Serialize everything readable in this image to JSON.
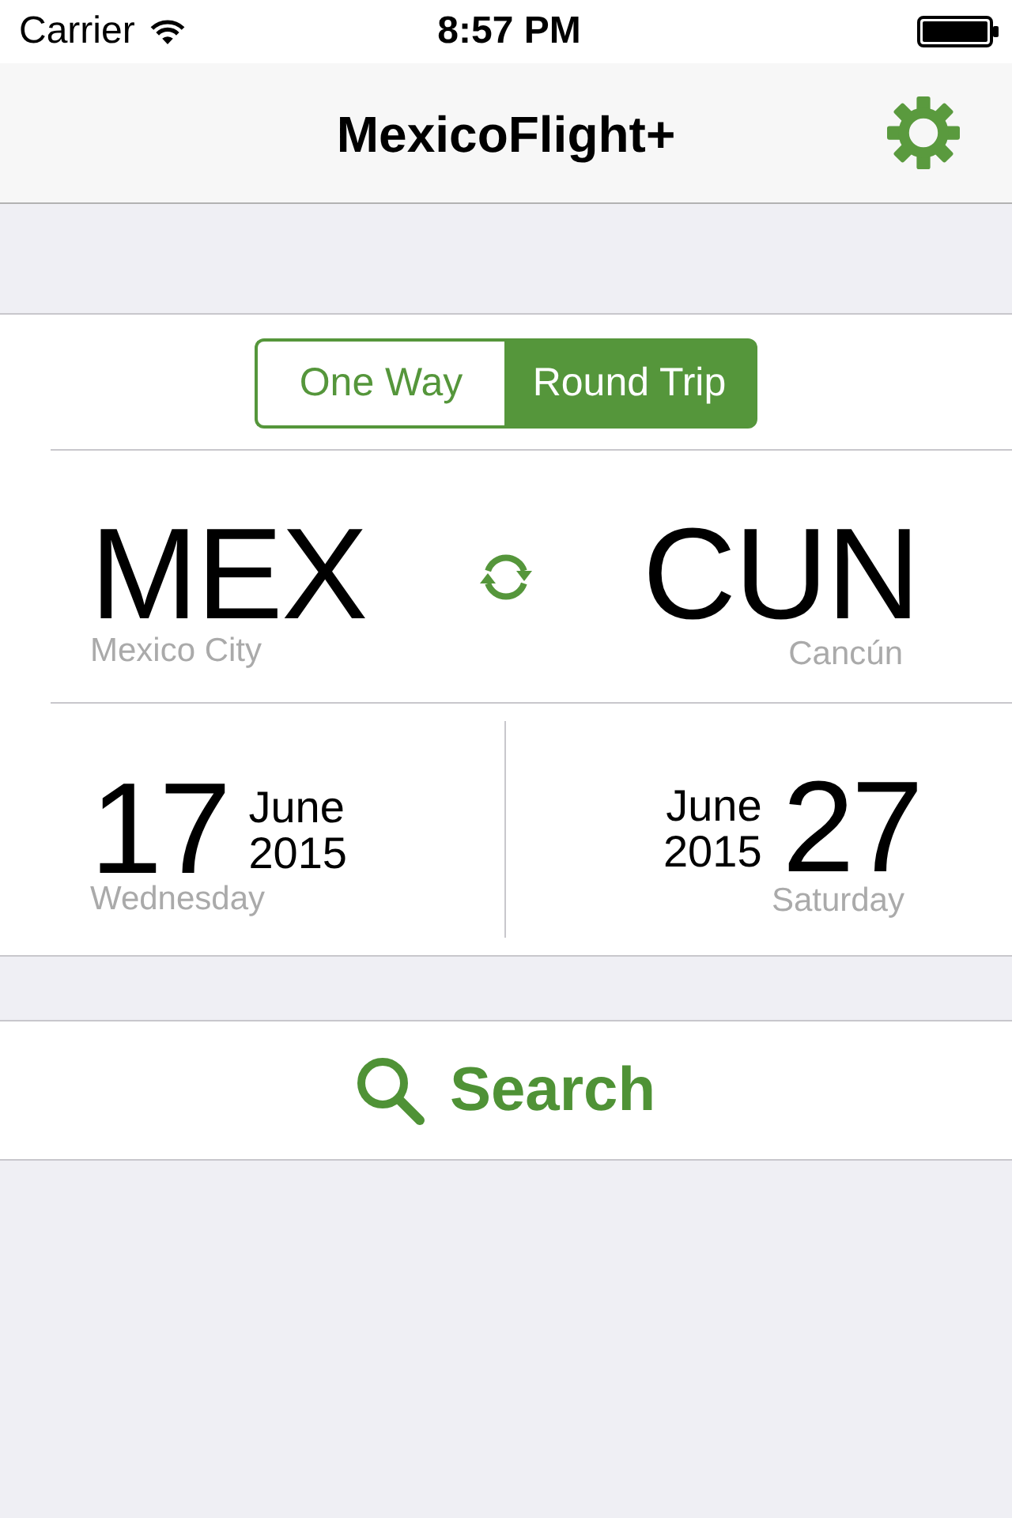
{
  "status_bar": {
    "carrier": "Carrier",
    "time": "8:57 PM"
  },
  "nav_bar": {
    "title": "MexicoFlight+"
  },
  "trip_type": [
    {
      "label": "One Way",
      "selected": false
    },
    {
      "label": "Round Trip",
      "selected": true
    }
  ],
  "route": {
    "origin": {
      "code": "MEX",
      "city": "Mexico City"
    },
    "destination": {
      "code": "CUN",
      "city": "Cancún"
    }
  },
  "dates": {
    "departure": {
      "day": "17",
      "month": "June",
      "year": "2015",
      "weekday": "Wednesday"
    },
    "return": {
      "day": "27",
      "month": "June",
      "year": "2015",
      "weekday": "Saturday"
    }
  },
  "search_button": {
    "label": "Search"
  }
}
